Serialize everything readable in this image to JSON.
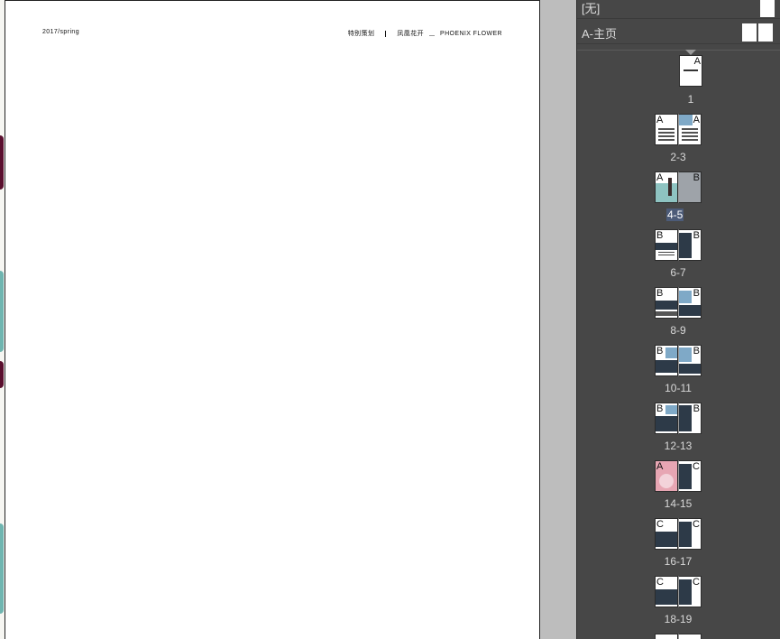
{
  "document": {
    "running_header_left": "2017/spring",
    "running_header_right_1": "特别策划",
    "running_header_right_2": "凤凰花开",
    "running_header_right_3": "PHOENIX FLOWER"
  },
  "pages_panel": {
    "masters": [
      {
        "label": "[无]"
      },
      {
        "label": "A-主页"
      }
    ],
    "spreads": [
      {
        "label": "1",
        "pages": [
          "A"
        ],
        "selected": false
      },
      {
        "label": "2-3",
        "pages": [
          "A",
          "A"
        ],
        "selected": false
      },
      {
        "label": "4-5",
        "pages": [
          "A",
          "B"
        ],
        "selected": true
      },
      {
        "label": "6-7",
        "pages": [
          "B",
          "B"
        ],
        "selected": false
      },
      {
        "label": "8-9",
        "pages": [
          "B",
          "B"
        ],
        "selected": false
      },
      {
        "label": "10-11",
        "pages": [
          "B",
          "B"
        ],
        "selected": false
      },
      {
        "label": "12-13",
        "pages": [
          "B",
          "B"
        ],
        "selected": false
      },
      {
        "label": "14-15",
        "pages": [
          "A",
          "C"
        ],
        "selected": false
      },
      {
        "label": "16-17",
        "pages": [
          "C",
          "C"
        ],
        "selected": false
      },
      {
        "label": "18-19",
        "pages": [
          "C",
          "C"
        ],
        "selected": false
      }
    ]
  }
}
